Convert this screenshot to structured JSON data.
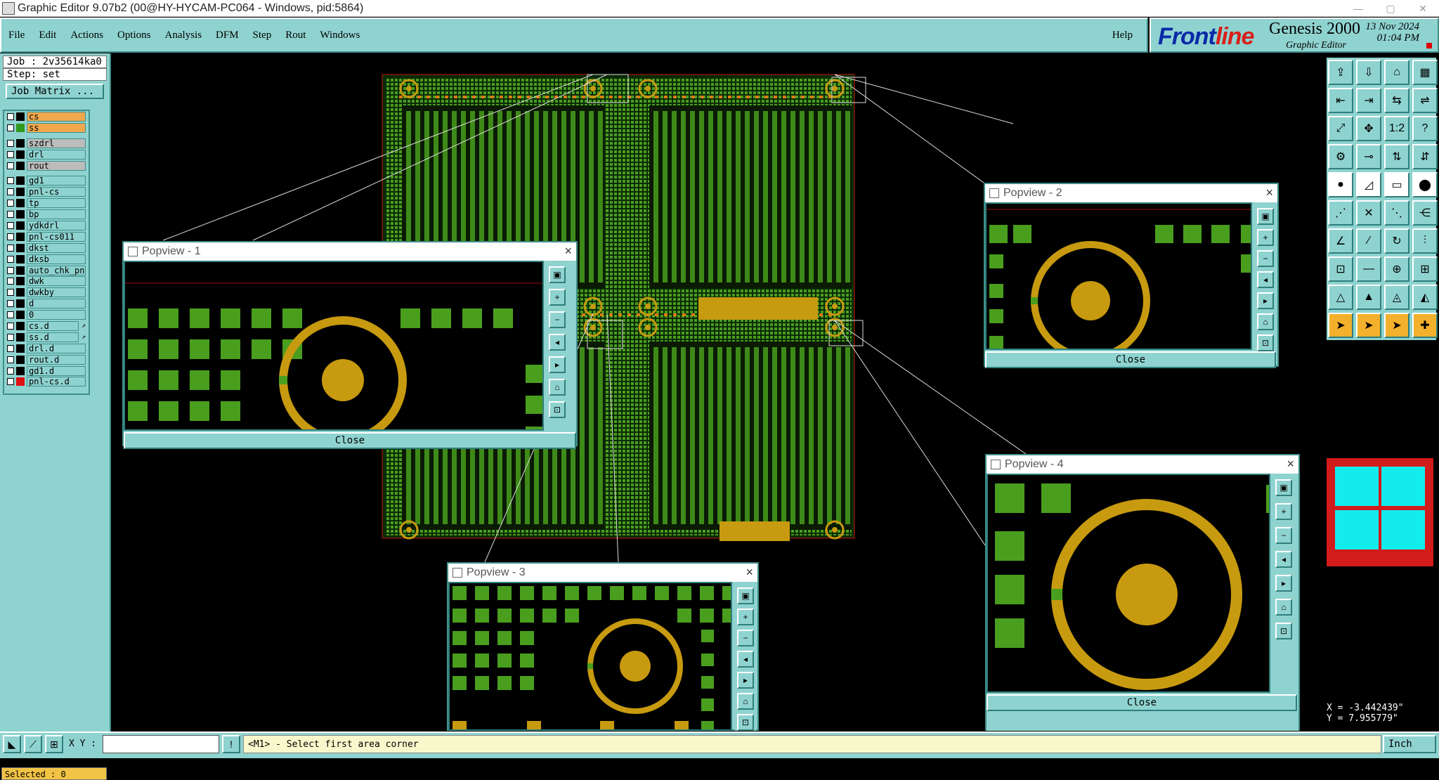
{
  "window": {
    "title": "Graphic Editor 9.07b2 (00@HY-HYCAM-PC064 - Windows, pid:5864)"
  },
  "menu": {
    "items": [
      "File",
      "Edit",
      "Actions",
      "Options",
      "Analysis",
      "DFM",
      "Step",
      "Rout",
      "Windows"
    ],
    "help": "Help"
  },
  "brand": {
    "logo_left": "Front",
    "logo_right": "line",
    "product": "Genesis 2000",
    "subtitle": "Graphic Editor",
    "date": "13 Nov 2024",
    "time": "01:04 PM"
  },
  "job": {
    "job": "Job : 2v35614ka0",
    "step": "Step: set",
    "matrix_button": "Job Matrix ..."
  },
  "layers": [
    {
      "name": "cs",
      "color": "#000000",
      "state": "on"
    },
    {
      "name": "ss",
      "color": "#2e9a1e",
      "state": "on"
    },
    {
      "name": "szdrl",
      "color": "#000000",
      "state": "grey"
    },
    {
      "name": "drl",
      "color": "#000000",
      "state": "off"
    },
    {
      "name": "rout",
      "color": "#000000",
      "state": "grey"
    },
    {
      "name": "gd1",
      "color": "#000000",
      "state": "off"
    },
    {
      "name": "pnl-cs",
      "color": "#000000",
      "state": "off"
    },
    {
      "name": "tp",
      "color": "#000000",
      "state": "off"
    },
    {
      "name": "bp",
      "color": "#000000",
      "state": "off"
    },
    {
      "name": "ydkdrl",
      "color": "#000000",
      "state": "off"
    },
    {
      "name": "pnl-cs011",
      "color": "#000000",
      "state": "off"
    },
    {
      "name": "dkst",
      "color": "#000000",
      "state": "off"
    },
    {
      "name": "dksb",
      "color": "#000000",
      "state": "off"
    },
    {
      "name": "auto_chk_pn",
      "color": "#000000",
      "state": "off"
    },
    {
      "name": "dwk",
      "color": "#000000",
      "state": "off"
    },
    {
      "name": "dwkby",
      "color": "#000000",
      "state": "off"
    },
    {
      "name": "d",
      "color": "#000000",
      "state": "off"
    },
    {
      "name": "0",
      "color": "#000000",
      "state": "off"
    },
    {
      "name": "cs.d",
      "color": "#000000",
      "state": "off"
    },
    {
      "name": "ss.d",
      "color": "#000000",
      "state": "off"
    },
    {
      "name": "drl.d",
      "color": "#000000",
      "state": "off"
    },
    {
      "name": "rout.d",
      "color": "#000000",
      "state": "off"
    },
    {
      "name": "gd1.d",
      "color": "#000000",
      "state": "off"
    },
    {
      "name": "pnl-cs.d",
      "color": "#e01010",
      "state": "off"
    }
  ],
  "selected": "Selected : 0",
  "popups": [
    {
      "title": "Popview - 1",
      "close": "Close"
    },
    {
      "title": "Popview - 2",
      "close": "Close"
    },
    {
      "title": "Popview - 3",
      "close": "Close"
    },
    {
      "title": "Popview - 4",
      "close": "Close"
    }
  ],
  "coords": {
    "x": "X = -3.442439\"",
    "y": "Y = 7.955779\""
  },
  "status": {
    "xy_label": "X Y :",
    "xy_value": "",
    "prompt": "<M1> - Select first area corner",
    "unit": "Inch"
  },
  "colors": {
    "pad": "#4a9e1e",
    "ring": "#c79a10",
    "bg": "#000000",
    "panel": "#8fd3d0"
  }
}
